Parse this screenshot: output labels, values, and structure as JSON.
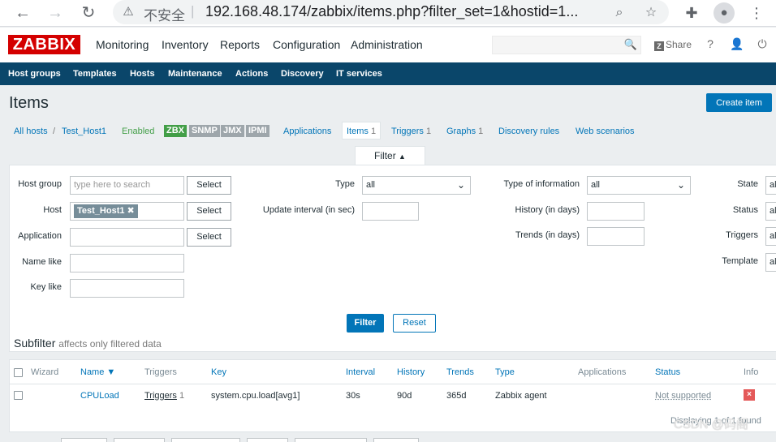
{
  "browser": {
    "insecure_label": "不安全",
    "url": "192.168.48.174/zabbix/items.php?filter_set=1&hostid=1..."
  },
  "header": {
    "logo": "ZABBIX",
    "nav": [
      "Monitoring",
      "Inventory",
      "Reports",
      "Configuration",
      "Administration"
    ],
    "share_label": "Share",
    "help_icon": "?"
  },
  "subnav": [
    "Host groups",
    "Templates",
    "Hosts",
    "Maintenance",
    "Actions",
    "Discovery",
    "IT services"
  ],
  "page": {
    "title": "Items",
    "create_button": "Create item"
  },
  "breadcrumb": {
    "all_hosts": "All hosts",
    "separator": "/",
    "host": "Test_Host1",
    "status": "Enabled",
    "badges": [
      {
        "label": "ZBX",
        "color": "#429e47"
      },
      {
        "label": "SNMP",
        "color": "#9ea6ab"
      },
      {
        "label": "JMX",
        "color": "#9ea6ab"
      },
      {
        "label": "IPMI",
        "color": "#9ea6ab"
      }
    ],
    "tabs": [
      {
        "label": "Applications",
        "count": ""
      },
      {
        "label": "Items",
        "count": "1"
      },
      {
        "label": "Triggers",
        "count": "1"
      },
      {
        "label": "Graphs",
        "count": "1"
      },
      {
        "label": "Discovery rules",
        "count": ""
      },
      {
        "label": "Web scenarios",
        "count": ""
      }
    ]
  },
  "filter": {
    "tab_label": "Filter",
    "tab_arrow": "▲",
    "host_group_label": "Host group",
    "host_group_placeholder": "type here to search",
    "host_label": "Host",
    "host_chip": "Test_Host1",
    "application_label": "Application",
    "name_like_label": "Name like",
    "key_like_label": "Key like",
    "select_label": "Select",
    "type_label": "Type",
    "type_value": "all",
    "update_interval_label": "Update interval (in sec)",
    "type_info_label": "Type of information",
    "type_info_value": "all",
    "history_label": "History (in days)",
    "trends_label": "Trends (in days)",
    "state_label": "State",
    "status_label": "Status",
    "triggers_label": "Triggers",
    "template_label": "Template",
    "right_value": "al",
    "filter_button": "Filter",
    "reset_button": "Reset",
    "subfilter_title": "Subfilter",
    "subfilter_note": "affects only filtered data"
  },
  "table": {
    "headers": {
      "wizard": "Wizard",
      "name": "Name ▼",
      "triggers": "Triggers",
      "key": "Key",
      "interval": "Interval",
      "history": "History",
      "trends": "Trends",
      "type": "Type",
      "applications": "Applications",
      "status": "Status",
      "info": "Info"
    },
    "rows": [
      {
        "name": "CPULoad",
        "triggers": "Triggers",
        "triggers_count": "1",
        "key": "system.cpu.load[avg1]",
        "interval": "30s",
        "history": "90d",
        "trends": "365d",
        "type": "Zabbix agent",
        "applications": "",
        "status": "Not supported",
        "info": "×"
      }
    ],
    "displaying": "Displaying 1 of 1 found"
  },
  "watermark": "CSDN @码阁"
}
